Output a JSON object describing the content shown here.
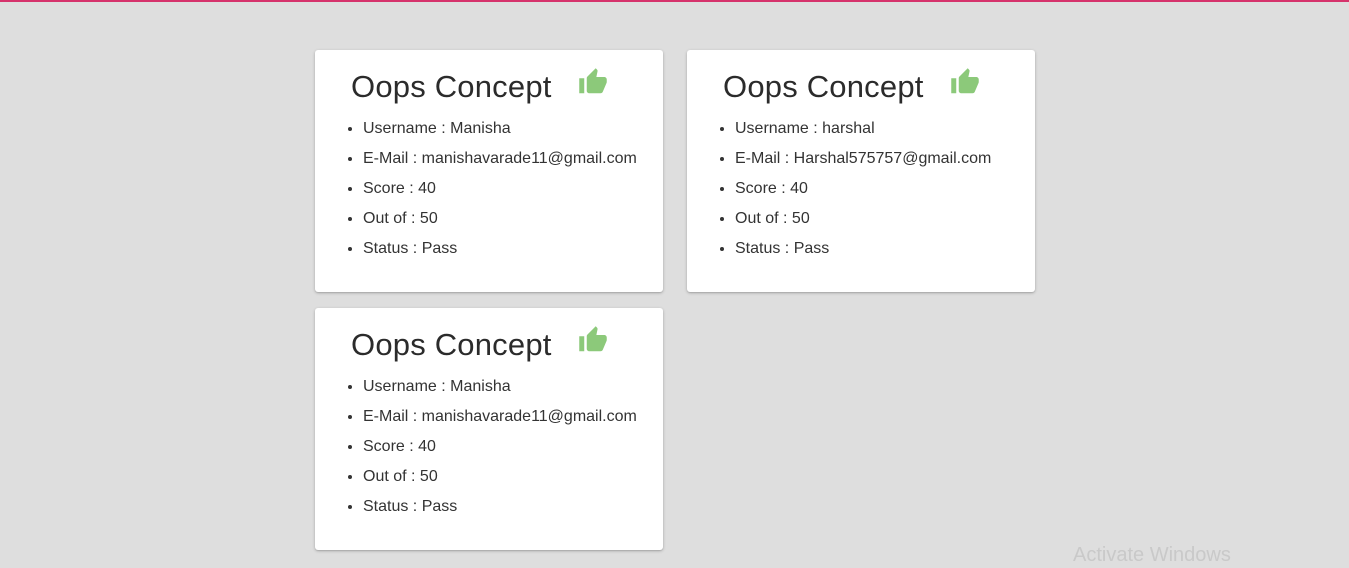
{
  "colors": {
    "background": "#dedede",
    "top_accent": "#d6336c",
    "card": "#ffffff",
    "thumb_icon": "#8cc97a",
    "text": "#333333"
  },
  "cards": [
    {
      "title": "Oops Concept",
      "icon": "thumbs-up-icon",
      "username": "Username : Manisha",
      "email": "E-Mail : manishavarade11@gmail.com",
      "score": "Score : 40",
      "out_of": "Out of : 50",
      "status": "Status : Pass"
    },
    {
      "title": "Oops Concept",
      "icon": "thumbs-up-icon",
      "username": "Username : harshal",
      "email": "E-Mail : Harshal575757@gmail.com",
      "score": "Score : 40",
      "out_of": "Out of : 50",
      "status": "Status : Pass"
    },
    {
      "title": "Oops Concept",
      "icon": "thumbs-up-icon",
      "username": "Username : Manisha",
      "email": "E-Mail : manishavarade11@gmail.com",
      "score": "Score : 40",
      "out_of": "Out of : 50",
      "status": "Status : Pass"
    }
  ],
  "watermark": "Activate Windows"
}
